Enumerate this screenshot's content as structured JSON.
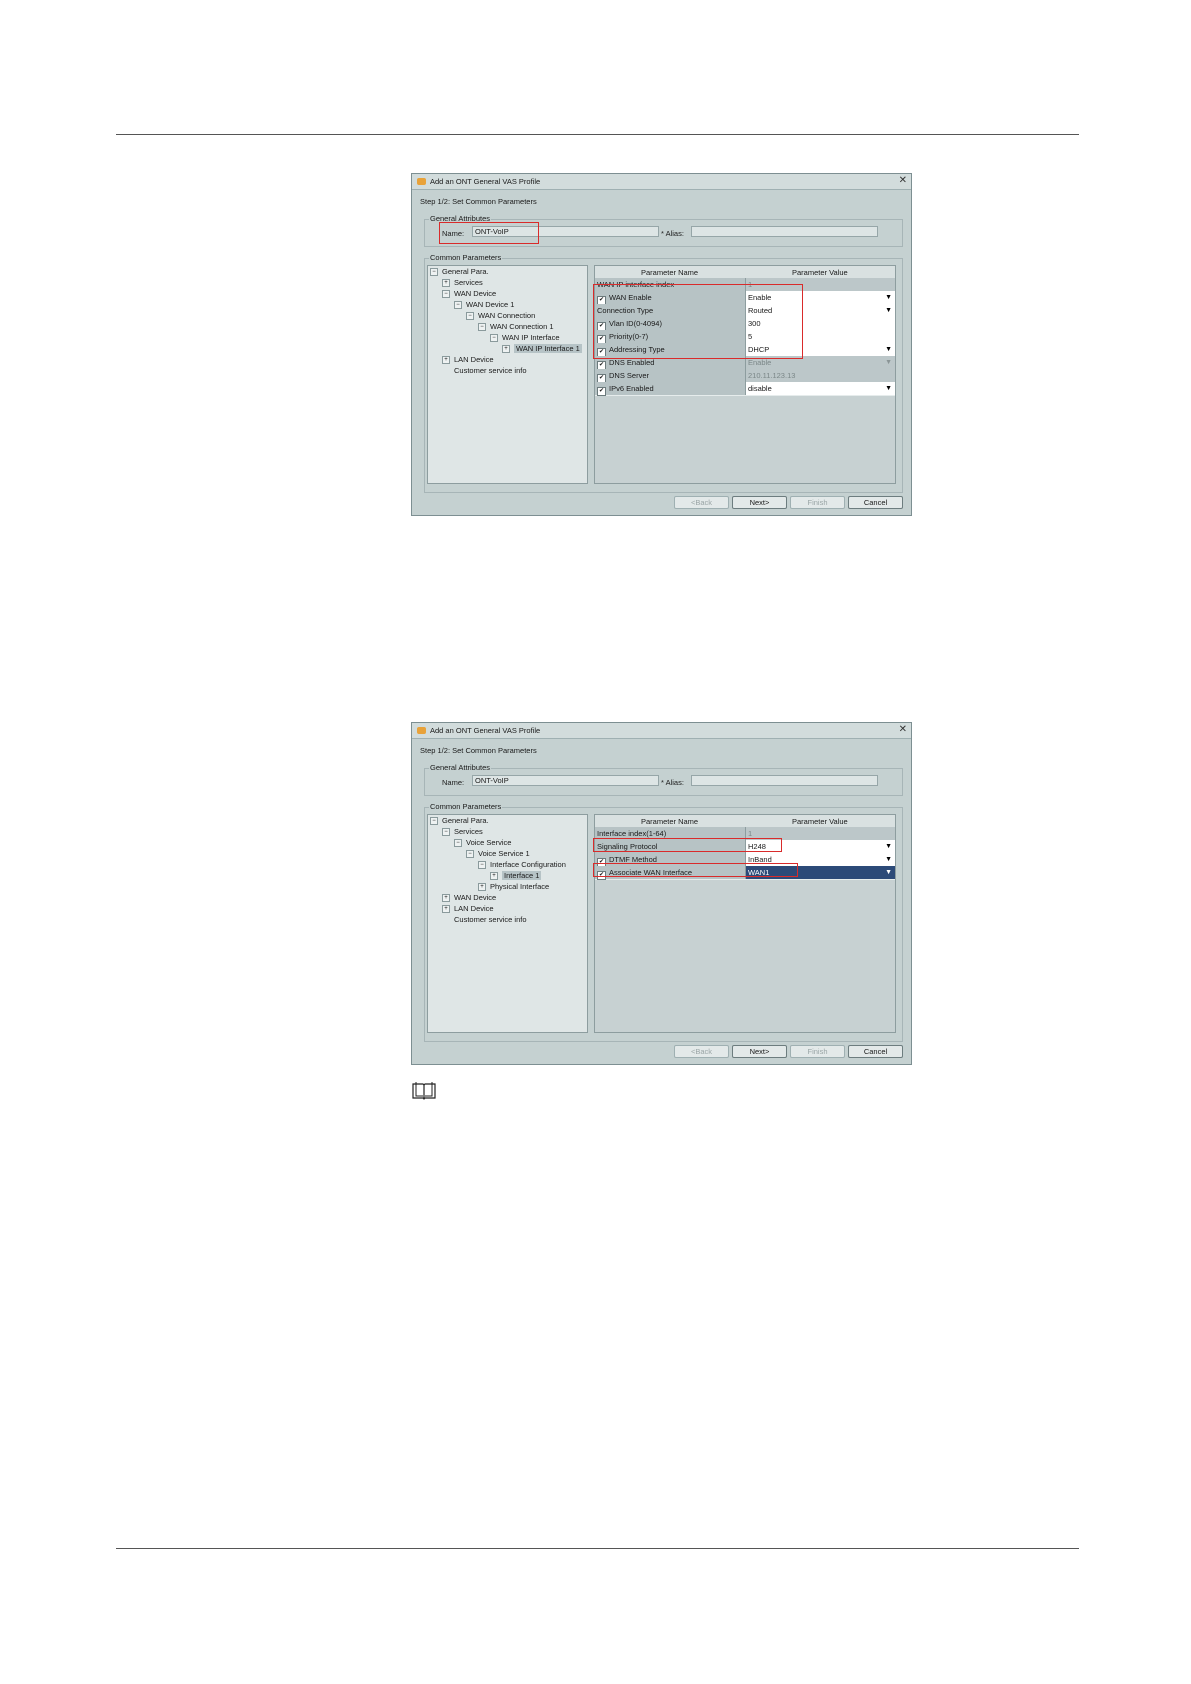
{
  "dialog1": {
    "title": "Add an ONT General VAS Profile",
    "step": "Step 1/2: Set Common Parameters",
    "general_attributes": "General Attributes",
    "name_label": "Name:",
    "name_value": "ONT-VoIP",
    "alias_label": "* Alias:",
    "alias_value": "",
    "common_parameters": "Common Parameters",
    "tree": [
      {
        "label": "General Para.",
        "expander": "−"
      },
      {
        "label": "Services",
        "expander": "+"
      },
      {
        "label": "WAN Device",
        "expander": "−"
      },
      {
        "label": "WAN Device 1",
        "expander": "−"
      },
      {
        "label": "WAN Connection",
        "expander": "−"
      },
      {
        "label": "WAN Connection 1",
        "expander": "−"
      },
      {
        "label": "WAN IP Interface",
        "expander": "−"
      },
      {
        "label": "WAN IP Interface 1",
        "expander": "+"
      },
      {
        "label": "LAN Device",
        "expander": "+"
      },
      {
        "label": "Customer service info",
        "expander": ""
      }
    ],
    "table_headers": [
      "Parameter Name",
      "Parameter Value"
    ],
    "rows": [
      {
        "name": "WAN IP interface index",
        "value": "1"
      },
      {
        "name": "WAN Enable",
        "value": "Enable"
      },
      {
        "name": "Connection Type",
        "value": "Routed"
      },
      {
        "name": "Vlan ID(0-4094)",
        "value": "300"
      },
      {
        "name": "Priority(0-7)",
        "value": "5"
      },
      {
        "name": "Addressing Type",
        "value": "DHCP"
      },
      {
        "name": "DNS Enabled",
        "value": "Enable"
      },
      {
        "name": "DNS Server",
        "value": "210.11.123.13"
      },
      {
        "name": "IPv6 Enabled",
        "value": "disable"
      }
    ],
    "buttons": {
      "back": "<Back",
      "next": "Next>",
      "finish": "Finish",
      "cancel": "Cancel"
    },
    "check_mark": "✔",
    "dropdown_arrow": "▼"
  },
  "dialog2": {
    "title": "Add an ONT General VAS Profile",
    "step": "Step 1/2: Set Common Parameters",
    "general_attributes": "General Attributes",
    "name_label": "Name:",
    "name_value": "ONT-VoIP",
    "alias_label": "* Alias:",
    "alias_value": "",
    "common_parameters": "Common Parameters",
    "tree": [
      {
        "label": "General Para.",
        "expander": "−"
      },
      {
        "label": "Services",
        "expander": "−"
      },
      {
        "label": "Voice Service",
        "expander": "−"
      },
      {
        "label": "Voice Service 1",
        "expander": "−"
      },
      {
        "label": "Interface Configuration",
        "expander": "−"
      },
      {
        "label": "Interface 1",
        "expander": "+"
      },
      {
        "label": "Physical Interface",
        "expander": "+"
      },
      {
        "label": "WAN Device",
        "expander": "+"
      },
      {
        "label": "LAN Device",
        "expander": "+"
      },
      {
        "label": "Customer service info",
        "expander": ""
      }
    ],
    "table_headers": [
      "Parameter Name",
      "Parameter Value"
    ],
    "rows": [
      {
        "name": "Interface index(1-64)",
        "value": "1"
      },
      {
        "name": "Signaling Protocol",
        "value": "H248"
      },
      {
        "name": "DTMF Method",
        "value": "InBand"
      },
      {
        "name": "Associate WAN Interface",
        "value": "WAN1"
      }
    ],
    "buttons": {
      "back": "<Back",
      "next": "Next>",
      "finish": "Finish",
      "cancel": "Cancel"
    },
    "check_mark": "✔",
    "dropdown_arrow": "▼"
  },
  "icons": {
    "note": "book-note-icon",
    "app": "vas-app-icon",
    "close": "close-icon"
  }
}
